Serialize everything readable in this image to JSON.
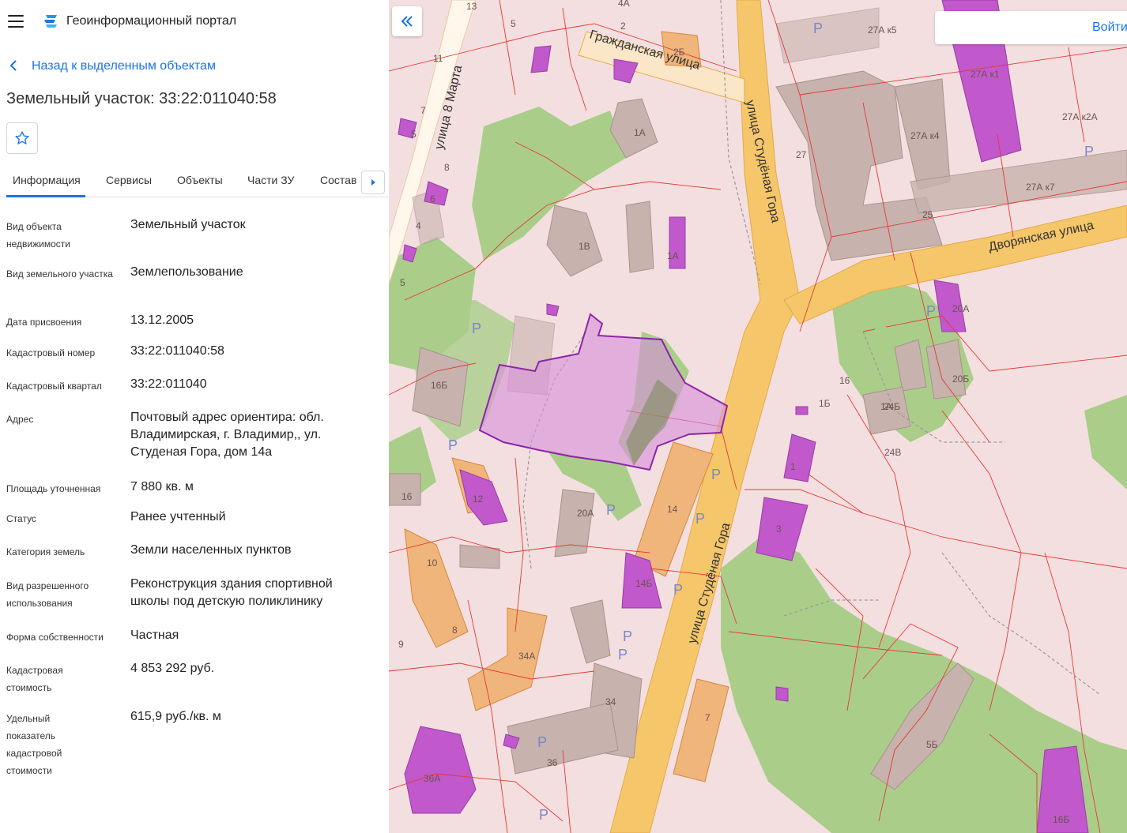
{
  "header": {
    "app_title": "Геоинформационный портал"
  },
  "navigation": {
    "back_label": "Назад к выделенным объектам"
  },
  "object": {
    "title": "Земельный участок: 33:22:011040:58"
  },
  "tabs": [
    {
      "label": "Информация",
      "active": true
    },
    {
      "label": "Сервисы",
      "active": false
    },
    {
      "label": "Объекты",
      "active": false
    },
    {
      "label": "Части ЗУ",
      "active": false
    },
    {
      "label": "Состав",
      "active": false
    }
  ],
  "properties": [
    {
      "label": "Вид объекта недвижимости",
      "value": "Земельный участок"
    },
    {
      "label": "Вид земельного участка",
      "value": "Землепользование"
    },
    {
      "label": "Дата присвоения",
      "value": "13.12.2005"
    },
    {
      "label": "Кадастровый номер",
      "value": "33:22:011040:58"
    },
    {
      "label": "Кадастровый квартал",
      "value": "33:22:011040"
    },
    {
      "label": "Адрес",
      "value": "Почтовый адрес ориентира: обл. Владимирская, г. Владимир,, ул. Студеная Гора, дом 14а"
    },
    {
      "label": "Площадь уточненная",
      "value": "7 880 кв. м"
    },
    {
      "label": "Статус",
      "value": "Ранее учтенный"
    },
    {
      "label": "Категория земель",
      "value": "Земли населенных пунктов"
    },
    {
      "label": "Вид разрешенного использования",
      "value": "Реконструкция здания спортивной школы под детскую поликлинику"
    },
    {
      "label": "Форма собственности",
      "value": "Частная"
    },
    {
      "label": "Кадастровая стоимость",
      "value": "4 853 292 руб."
    },
    {
      "label": "Удельный показатель кадастровой стоимости",
      "value": "615,9 руб./кв. м"
    }
  ],
  "map": {
    "login_label": "Войти",
    "streets": {
      "grazhdanskaya": "Гражданская улица",
      "studenaya_north": "улица Студёная Гора",
      "studenaya_south": "улица Студёная Гора",
      "dvoryanskaya": "Дворянская улица",
      "marta": "улица 8 Марта"
    },
    "labels": [
      "27А к5",
      "27А к1",
      "27А к2А",
      "27А к4",
      "27",
      "27А к7",
      "25",
      "2Б",
      "1А",
      "1В",
      "1А",
      "20А",
      "16",
      "20Б",
      "1Б",
      "1А",
      "24Б",
      "24В",
      "1",
      "16Б",
      "12",
      "20А",
      "14",
      "16",
      "10",
      "14Б",
      "3",
      "8",
      "34А",
      "34",
      "7",
      "36",
      "36А",
      "5Б",
      "16Б",
      "13",
      "5",
      "4А",
      "2",
      "11",
      "7",
      "5",
      "8",
      "6",
      "4",
      "5",
      "9"
    ],
    "parking": "P",
    "colors": {
      "selected": "#b04fc4",
      "road": "#f5c66a",
      "green": "#9ccb7a",
      "bg": "#f4dfe0",
      "boundary": "#e53935",
      "accent": "#1a73e8"
    }
  }
}
